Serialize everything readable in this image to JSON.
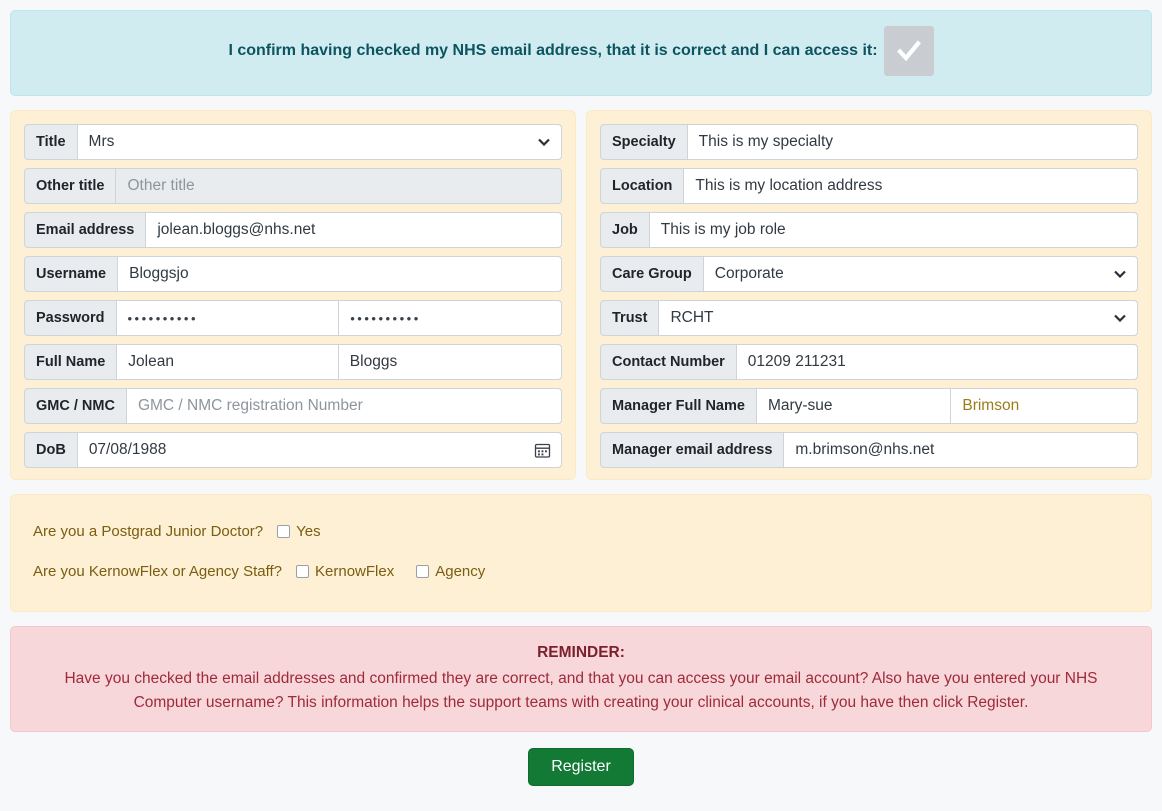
{
  "confirm": {
    "text": "I confirm having checked my NHS email address, that it is correct and I can access it:",
    "checked": true,
    "checkbox_icon": "check-icon"
  },
  "left_panel": {
    "fields": [
      {
        "label": "Title",
        "value": "Mrs",
        "type": "select",
        "icon": "chevron-down-icon"
      },
      {
        "label": "Other title",
        "value": "",
        "placeholder": "Other title",
        "type": "text-disabled"
      },
      {
        "label": "Email address",
        "value": "jolean.bloggs@nhs.net",
        "type": "text"
      },
      {
        "label": "Username",
        "value": "Bloggsjo",
        "type": "text"
      },
      {
        "label": "Password",
        "value": "••••••••••",
        "value2": "••••••••••",
        "type": "password-pair"
      },
      {
        "label": "Full Name",
        "value": "Jolean",
        "value2": "Bloggs",
        "type": "text-pair"
      },
      {
        "label": "GMC / NMC",
        "value": "",
        "placeholder": "GMC / NMC registration Number",
        "type": "text"
      },
      {
        "label": "DoB",
        "value": "07/08/1988",
        "type": "date",
        "icon": "calendar-icon"
      }
    ]
  },
  "right_panel": {
    "fields": [
      {
        "label": "Specialty",
        "value": "This is my specialty",
        "type": "text"
      },
      {
        "label": "Location",
        "value": "This is my location address",
        "type": "text"
      },
      {
        "label": "Job",
        "value": "This is my job role",
        "type": "text"
      },
      {
        "label": "Care Group",
        "value": "Corporate",
        "type": "select",
        "icon": "chevron-down-icon"
      },
      {
        "label": "Trust",
        "value": "RCHT",
        "type": "select",
        "icon": "chevron-down-icon"
      },
      {
        "label": "Contact Number",
        "value": "01209 211231",
        "type": "text"
      },
      {
        "label": "Manager Full Name",
        "value": "Mary-sue",
        "value2": "Brimson",
        "value2_color": "#9a7d1a",
        "type": "text-pair"
      },
      {
        "label": "Manager email address",
        "value": "m.brimson@nhs.net",
        "type": "text"
      }
    ]
  },
  "questions": [
    {
      "question": "Are you a Postgrad Junior Doctor?",
      "options": [
        {
          "label": "Yes",
          "checked": false
        }
      ]
    },
    {
      "question": "Are you KernowFlex or Agency Staff?",
      "options": [
        {
          "label": "KernowFlex",
          "checked": false
        },
        {
          "label": "Agency",
          "checked": false
        }
      ]
    }
  ],
  "reminder": {
    "title": "REMINDER:",
    "body": "Have you checked the email addresses and confirmed they are correct, and that you can access your email account? Also have you entered your NHS Computer username? This information helps the support teams with creating your clinical accounts, if you have then click Register."
  },
  "register": {
    "label": "Register"
  },
  "colors": {
    "banner_bg": "#d1ecf1",
    "banner_text": "#0c5460",
    "panel_bg": "#fdf0d5",
    "label_bg": "#e9ecef",
    "reminder_bg": "#f8d7da",
    "reminder_text": "#9e2a3a",
    "register_bg": "#127a35",
    "olive_value": "#9a7d1a",
    "question_text": "#7a5d10"
  }
}
